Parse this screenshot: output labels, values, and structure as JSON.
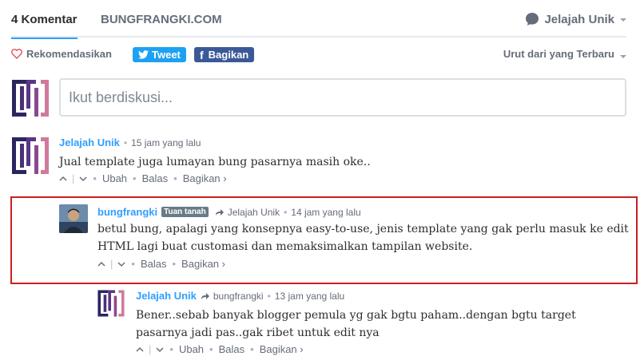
{
  "nav": {
    "tab_comments": "4 Komentar",
    "tab_site": "BUNGFRANGKI.COM",
    "user_name": "Jelajah Unik"
  },
  "actions": {
    "recommend": "Rekomendasikan",
    "tweet": "Tweet",
    "share": "Bagikan",
    "sort": "Urut dari yang Terbaru"
  },
  "composer": {
    "placeholder": "Ikut berdiskusi..."
  },
  "comments": [
    {
      "author": "Jelajah Unik",
      "time": "15 jam yang lalu",
      "text": "Jual template juga lumayan bung pasarnya masih oke..",
      "actions": [
        "Ubah",
        "Balas",
        "Bagikan ›"
      ]
    },
    {
      "author": "bungfrangki",
      "badge": "Tuan tanah",
      "reply_to": "Jelajah Unik",
      "time": "14 jam yang lalu",
      "text": "betul bung, apalagi yang konsepnya easy-to-use, jenis template yang gak perlu masuk ke edit HTML lagi buat customasi dan memaksimalkan tampilan website.",
      "actions": [
        "Balas",
        "Bagikan ›"
      ]
    },
    {
      "author": "Jelajah Unik",
      "reply_to": "bungfrangki",
      "time": "13 jam yang lalu",
      "text": "Bener..sebab banyak blogger pemula yg gak bgtu paham..dengan bgtu target pasarnya jadi pas..gak ribet untuk edit nya",
      "actions": [
        "Ubah",
        "Balas",
        "Bagikan ›"
      ]
    }
  ],
  "colors": {
    "accent": "#2e9fff",
    "highlight_border": "#cc1f1f",
    "twitter": "#1da1f2",
    "facebook": "#3b5998"
  }
}
